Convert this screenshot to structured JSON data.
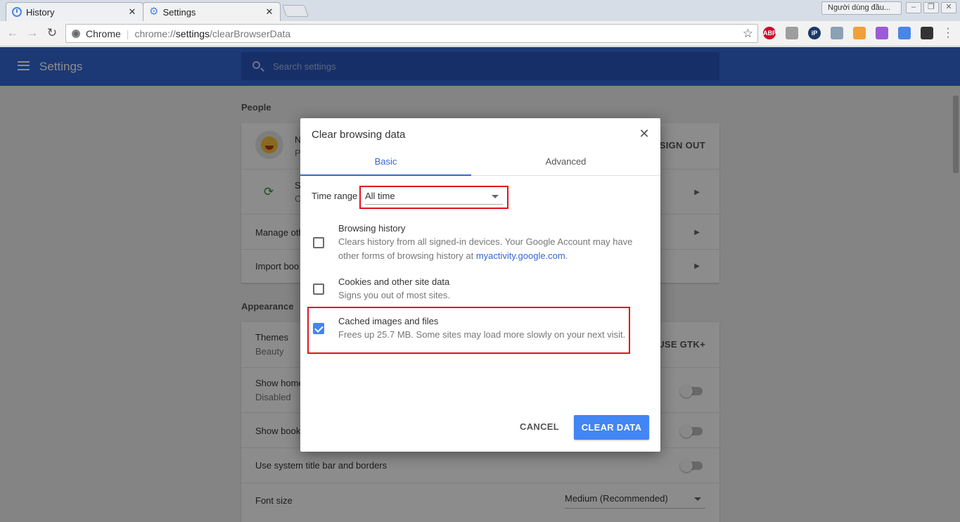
{
  "tabs": [
    {
      "title": "History",
      "icon": "history-icon"
    },
    {
      "title": "Settings",
      "icon": "gear-icon"
    }
  ],
  "profile_name": "Người dùng đầu...",
  "omnibox": {
    "chip_label": "Chrome",
    "url_prefix": "chrome://",
    "url_host": "settings",
    "url_path": "/clearBrowserData"
  },
  "extensions": [
    {
      "name": "adblock-plus-icon",
      "label": "ABP",
      "color": "#c70d2c"
    },
    {
      "name": "extension-doc-icon",
      "label": "",
      "color": "#9e9e9e"
    },
    {
      "name": "ip-extension-icon",
      "label": "iP",
      "color": "#1a3a6b"
    },
    {
      "name": "download-arrow-icon",
      "label": "",
      "color": "#8aa0b4"
    },
    {
      "name": "eyedropper-icon",
      "label": "",
      "color": "#f29f3b"
    },
    {
      "name": "feather-icon",
      "label": "",
      "color": "#9c5bd6"
    },
    {
      "name": "extension-blue-icon",
      "label": "",
      "color": "#4a86e8"
    },
    {
      "name": "downloader-icon",
      "label": "",
      "color": "#333333"
    }
  ],
  "appbar": {
    "title": "Settings",
    "search_placeholder": "Search settings"
  },
  "people": {
    "section_title": "People",
    "account_name_start": "N",
    "account_sub_start": "P",
    "sign_out": "SIGN OUT",
    "sync_label_start": "S",
    "sync_sub_start": "O",
    "manage_other": "Manage oth",
    "import_books": "Import boo"
  },
  "appearance": {
    "section_title": "Appearance",
    "themes_label": "Themes",
    "themes_value": "Beauty",
    "use_gtk": "USE GTK+",
    "show_home_label": "Show home",
    "show_home_value": "Disabled",
    "show_bookmarks_label": "Show book",
    "system_titlebar_label": "Use system title bar and borders",
    "font_size_label": "Font size",
    "font_size_value": "Medium (Recommended)"
  },
  "dialog": {
    "title": "Clear browsing data",
    "tab_basic": "Basic",
    "tab_advanced": "Advanced",
    "time_range_label": "Time range",
    "time_range_value": "All time",
    "options": [
      {
        "title": "Browsing history",
        "desc_before": "Clears history from all signed-in devices. Your Google Account may have other forms of browsing history at ",
        "desc_link": "myactivity.google.com",
        "desc_after": ".",
        "checked": false
      },
      {
        "title": "Cookies and other site data",
        "desc": "Signs you out of most sites.",
        "checked": false
      },
      {
        "title": "Cached images and files",
        "desc": "Frees up 25.7 MB. Some sites may load more slowly on your next visit.",
        "checked": true
      }
    ],
    "cancel": "CANCEL",
    "clear_data": "CLEAR DATA"
  },
  "colors": {
    "accent": "#3367d6",
    "button_blue": "#4285f4",
    "highlight_red": "#e0141e"
  }
}
